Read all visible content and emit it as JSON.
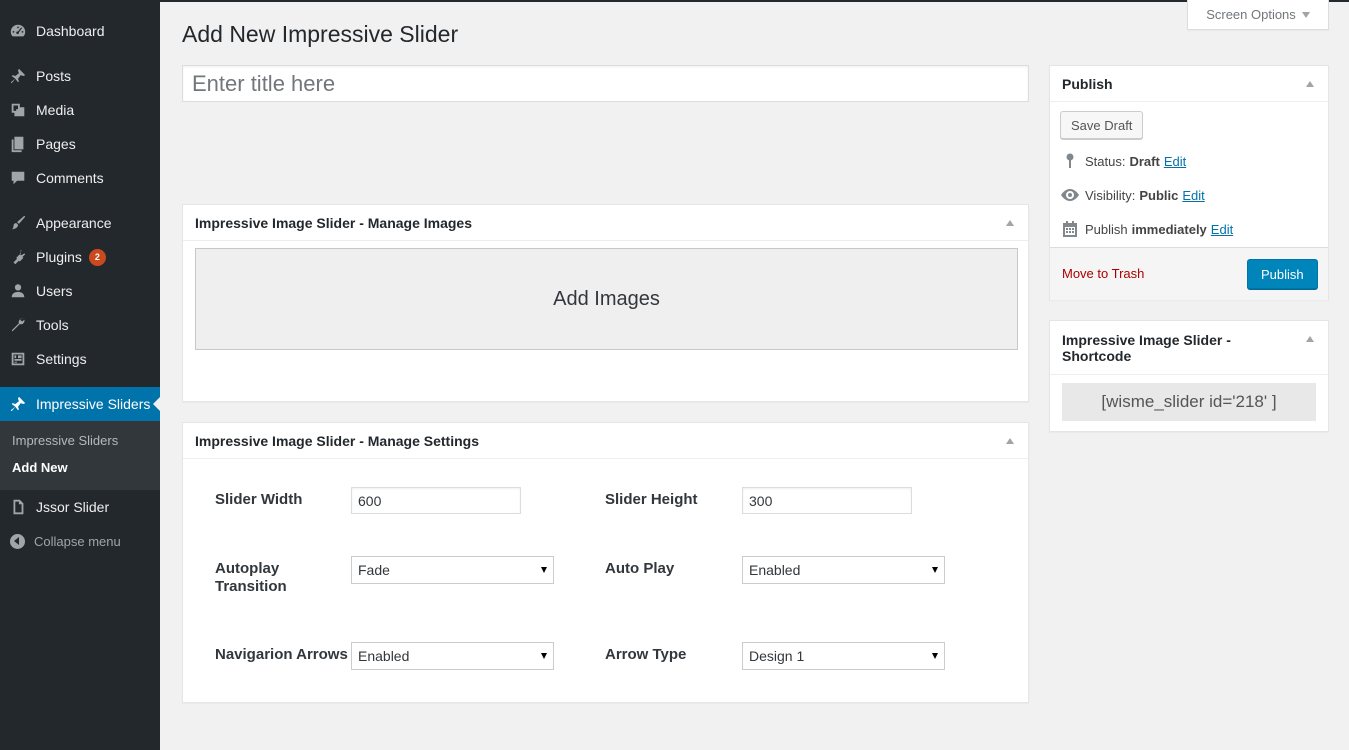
{
  "sidebar": {
    "items": [
      {
        "label": "Dashboard",
        "icon": "dashboard-icon"
      },
      {
        "label": "Posts",
        "icon": "pin-icon"
      },
      {
        "label": "Media",
        "icon": "media-icon"
      },
      {
        "label": "Pages",
        "icon": "pages-icon"
      },
      {
        "label": "Comments",
        "icon": "comment-icon"
      },
      {
        "label": "Appearance",
        "icon": "brush-icon"
      },
      {
        "label": "Plugins",
        "icon": "plugin-icon",
        "badge": "2"
      },
      {
        "label": "Users",
        "icon": "user-icon"
      },
      {
        "label": "Tools",
        "icon": "wrench-icon"
      },
      {
        "label": "Settings",
        "icon": "settings-icon"
      },
      {
        "label": "Impressive Sliders",
        "icon": "pin-icon"
      },
      {
        "label": "Jssor Slider",
        "icon": "page-icon"
      }
    ],
    "submenu": [
      "Impressive Sliders",
      "Add New"
    ],
    "collapse_label": "Collapse menu"
  },
  "screen_options": "Screen Options",
  "page_title": "Add New Impressive Slider",
  "title_input": {
    "placeholder": "Enter title here",
    "value": ""
  },
  "manage_images": {
    "title": "Impressive Image Slider - Manage Images",
    "add_images_label": "Add Images"
  },
  "manage_settings": {
    "title": "Impressive Image Slider - Manage Settings",
    "slider_width_label": "Slider Width",
    "slider_width_value": "600",
    "slider_height_label": "Slider Height",
    "slider_height_value": "300",
    "autoplay_transition_label_1": "Autoplay",
    "autoplay_transition_label_2": "Transition",
    "autoplay_transition_value": "Fade",
    "auto_play_label": "Auto Play",
    "auto_play_value": "Enabled",
    "navigation_arrows_label": "Navigarion Arrows",
    "navigation_arrows_value": "Enabled",
    "arrow_type_label": "Arrow Type",
    "arrow_type_value": "Design 1"
  },
  "publish": {
    "title": "Publish",
    "save_draft": "Save Draft",
    "status_label": "Status:",
    "status_value": "Draft",
    "visibility_label": "Visibility:",
    "visibility_value": "Public",
    "publish_label": "Publish",
    "publish_value": "immediately",
    "edit_label": "Edit",
    "move_to_trash": "Move to Trash",
    "publish_button": "Publish"
  },
  "shortcode": {
    "title_line1": "Impressive Image Slider -",
    "title_line2": "Shortcode",
    "value": "[wisme_slider id='218' ]"
  },
  "colors": {
    "sidebar_bg": "#23282d",
    "accent": "#0073aa",
    "primary_button": "#0085ba",
    "badge": "#ca4a1f",
    "trash": "#aa0000"
  }
}
